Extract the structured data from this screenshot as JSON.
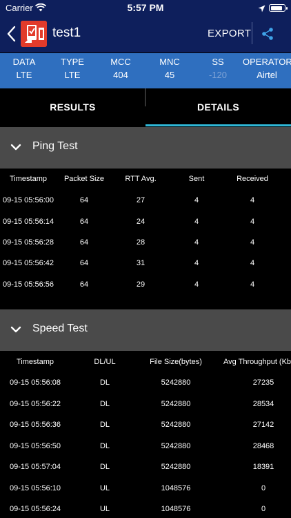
{
  "status_bar": {
    "carrier": "Carrier",
    "time": "5:57 PM"
  },
  "nav": {
    "title": "test1",
    "export_label": "EXPORT"
  },
  "info": [
    {
      "label": "DATA",
      "value": "LTE",
      "dim": false
    },
    {
      "label": "TYPE",
      "value": "LTE",
      "dim": false
    },
    {
      "label": "MCC",
      "value": "404",
      "dim": false
    },
    {
      "label": "MNC",
      "value": "45",
      "dim": false
    },
    {
      "label": "SS",
      "value": "-120",
      "dim": true
    },
    {
      "label": "OPERATOR",
      "value": "Airtel",
      "dim": false
    }
  ],
  "tabs": {
    "results": "RESULTS",
    "details": "DETAILS"
  },
  "ping_test": {
    "title": "Ping Test",
    "columns": [
      "Timestamp",
      "Packet Size",
      "RTT Avg.",
      "Sent",
      "Received"
    ],
    "rows": [
      [
        "09-15 05:56:00",
        "64",
        "27",
        "4",
        "4"
      ],
      [
        "09-15 05:56:14",
        "64",
        "24",
        "4",
        "4"
      ],
      [
        "09-15 05:56:28",
        "64",
        "28",
        "4",
        "4"
      ],
      [
        "09-15 05:56:42",
        "64",
        "31",
        "4",
        "4"
      ],
      [
        "09-15 05:56:56",
        "64",
        "29",
        "4",
        "4"
      ]
    ]
  },
  "speed_test": {
    "title": "Speed Test",
    "columns": [
      "Timestamp",
      "DL/UL",
      "File Size(bytes)",
      "Avg Throughput (Kb"
    ],
    "rows": [
      [
        "09-15 05:56:08",
        "DL",
        "5242880",
        "27235"
      ],
      [
        "09-15 05:56:22",
        "DL",
        "5242880",
        "28534"
      ],
      [
        "09-15 05:56:36",
        "DL",
        "5242880",
        "27142"
      ],
      [
        "09-15 05:56:50",
        "DL",
        "5242880",
        "28468"
      ],
      [
        "09-15 05:57:04",
        "DL",
        "5242880",
        "18391"
      ],
      [
        "09-15 05:56:10",
        "UL",
        "1048576",
        "0"
      ],
      [
        "09-15 05:56:24",
        "UL",
        "1048576",
        "0"
      ]
    ]
  }
}
